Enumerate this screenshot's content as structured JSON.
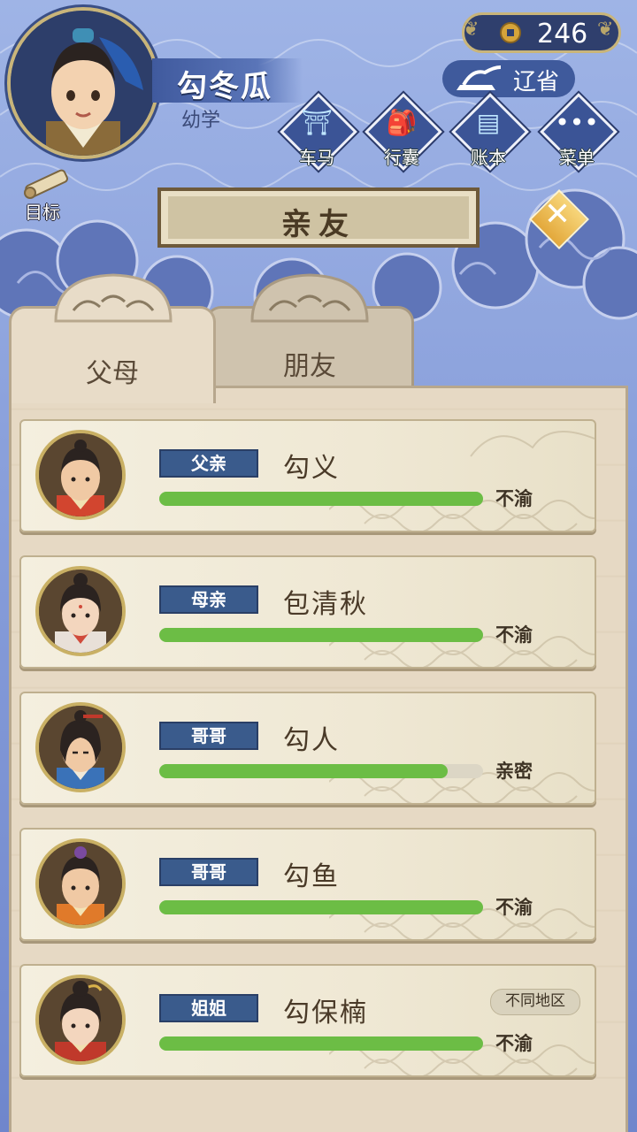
{
  "player": {
    "name": "勾冬瓜",
    "rank": "幼学"
  },
  "currency": {
    "icon": "copper-coin-icon",
    "value": "246"
  },
  "location": {
    "icon": "iron-lamp-icon",
    "label": "辽省"
  },
  "menu": [
    {
      "label": "车马",
      "icon": "carriage-icon"
    },
    {
      "label": "行囊",
      "icon": "bundle-icon"
    },
    {
      "label": "账本",
      "icon": "ledger-icon"
    },
    {
      "label": "菜单",
      "icon": "more-icon"
    }
  ],
  "goal": {
    "label": "目标",
    "icon": "scroll-icon"
  },
  "title": "亲友",
  "tabs": [
    {
      "label": "父母",
      "active": true
    },
    {
      "label": "朋友",
      "active": false
    }
  ],
  "relatives": [
    {
      "relation": "父亲",
      "name": "勾义",
      "status": "不渝",
      "affinity": 1.0,
      "region": ""
    },
    {
      "relation": "母亲",
      "name": "包清秋",
      "status": "不渝",
      "affinity": 1.0,
      "region": ""
    },
    {
      "relation": "哥哥",
      "name": "勾人",
      "status": "亲密",
      "affinity": 0.89,
      "region": ""
    },
    {
      "relation": "哥哥",
      "name": "勾鱼",
      "status": "不渝",
      "affinity": 1.0,
      "region": ""
    },
    {
      "relation": "姐姐",
      "name": "勾保楠",
      "status": "不渝",
      "affinity": 1.0,
      "region": "不同地区"
    }
  ],
  "colors": {
    "bar": "#6cbd45",
    "tag": "#3a5b8c",
    "sky": "#8aa0db"
  }
}
